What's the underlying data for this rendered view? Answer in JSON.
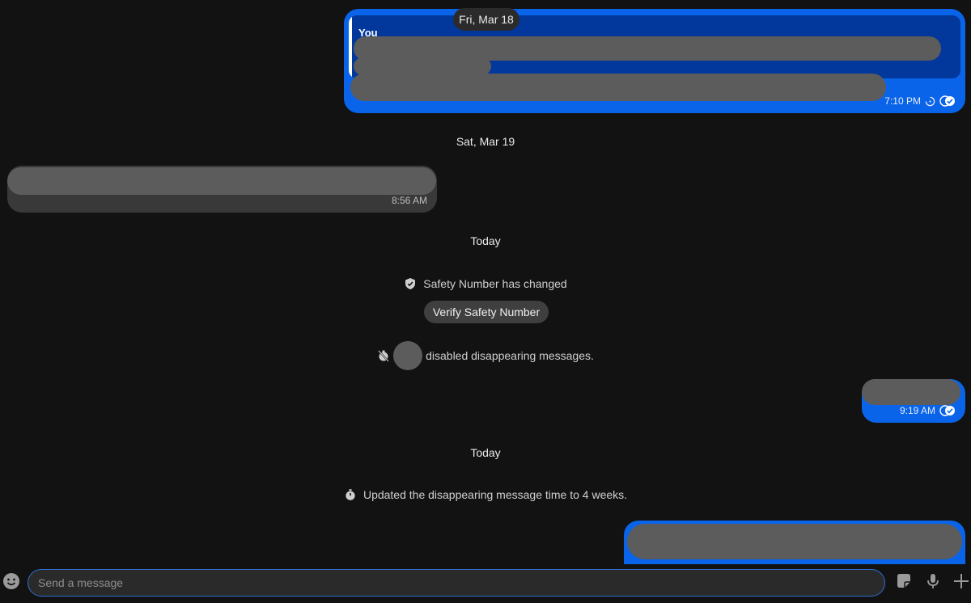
{
  "conversation": {
    "sticky_date": "Fri, Mar 18",
    "messages": [
      {
        "id": "m1",
        "direction": "outgoing",
        "quote_author": "You",
        "time": "7:10 PM",
        "status_icons": [
          "sending-spinner-icon",
          "delivered-check-icon"
        ]
      },
      {
        "id": "m2",
        "direction": "incoming",
        "time": "8:56 AM"
      },
      {
        "id": "m3",
        "direction": "outgoing",
        "time": "9:19 AM",
        "status_icons": [
          "delivered-check-icon"
        ]
      }
    ],
    "dividers": {
      "sat": "Sat, Mar 19",
      "today_1": "Today",
      "today_2": "Today"
    },
    "system": {
      "safety_number_text": "Safety Number has changed",
      "verify_button_label": "Verify Safety Number",
      "disabled_disappearing_text": "disabled disappearing messages.",
      "updated_timer_text": "Updated the disappearing message time to 4 weeks."
    }
  },
  "composer": {
    "placeholder": "Send a message",
    "value": "",
    "icons": [
      "emoji-icon",
      "sticker-icon",
      "microphone-icon",
      "attach-plus-icon"
    ]
  },
  "colors": {
    "background": "#121212",
    "outgoing_bubble": "#0a64ea",
    "incoming_bubble": "#393939",
    "quote_background": "#02389c",
    "redaction": "#5c5c5c"
  }
}
